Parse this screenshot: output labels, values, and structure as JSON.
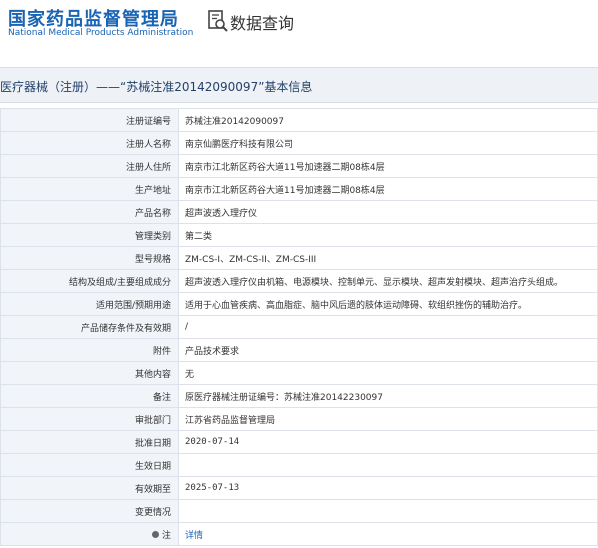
{
  "header": {
    "logo_cn": "国家药品监督管理局",
    "logo_en": "National Medical Products Administration",
    "db_title": "数据查询",
    "db_icon": "search-document-icon"
  },
  "section": {
    "title": "医疗器械（注册）——“苏械注准20142090097”基本信息"
  },
  "rows": [
    {
      "label": "注册证编号",
      "value": "苏械注准20142090097"
    },
    {
      "label": "注册人名称",
      "value": "南京仙鹏医疗科技有限公司"
    },
    {
      "label": "注册人住所",
      "value": "南京市江北新区药谷大道11号加速器二期08栋4层"
    },
    {
      "label": "生产地址",
      "value": "南京市江北新区药谷大道11号加速器二期08栋4层"
    },
    {
      "label": "产品名称",
      "value": "超声波透入理疗仪"
    },
    {
      "label": "管理类别",
      "value": "第二类"
    },
    {
      "label": "型号规格",
      "value": "ZM-CS-I、ZM-CS-II、ZM-CS-III"
    },
    {
      "label": "结构及组成/主要组成成分",
      "value": "超声波透入理疗仪由机箱、电源模块、控制单元、显示模块、超声发射模块、超声治疗头组成。"
    },
    {
      "label": "适用范围/预期用途",
      "value": "适用于心血管疾病、高血脂症、脑中风后遗的肢体运动障碍、软组织挫伤的辅助治疗。"
    },
    {
      "label": "产品储存条件及有效期",
      "value": "/"
    },
    {
      "label": "附件",
      "value": "产品技术要求"
    },
    {
      "label": "其他内容",
      "value": "无"
    },
    {
      "label": "备注",
      "value": "原医疗器械注册证编号：苏械注准20142230097"
    },
    {
      "label": "审批部门",
      "value": "江苏省药品监督管理局"
    },
    {
      "label": "批准日期",
      "value": "2020-07-14"
    },
    {
      "label": "生效日期",
      "value": ""
    },
    {
      "label": "有效期至",
      "value": "2025-07-13"
    },
    {
      "label": "变更情况",
      "value": ""
    },
    {
      "label": "注",
      "value": "详情"
    }
  ]
}
